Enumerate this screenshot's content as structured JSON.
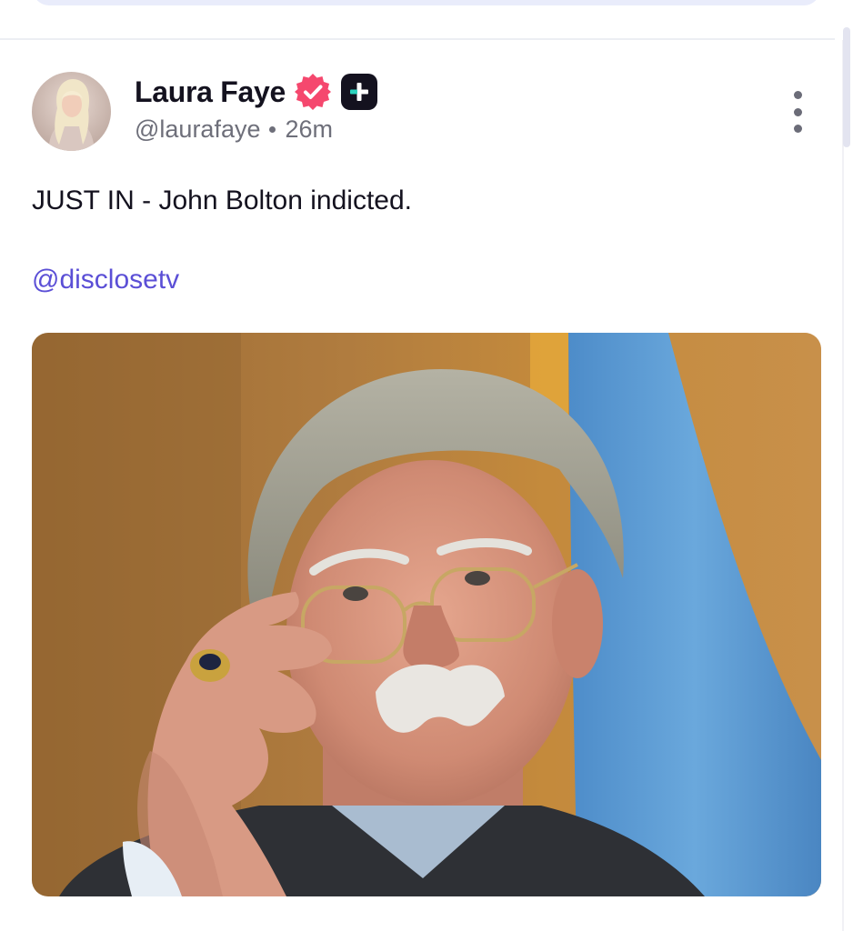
{
  "post": {
    "author": {
      "display_name": "Laura Faye",
      "handle": "@laurafaye",
      "verified_icon": "verified-badge-icon",
      "subscription_icon": "plus-badge-icon"
    },
    "time_ago": "26m",
    "text": "JUST IN - John Bolton indicted.",
    "mention": "@disclosetv",
    "more_icon": "more-vertical-icon"
  },
  "colors": {
    "mention": "#5b4fd6",
    "verified_badge": "#f5486e",
    "plus_badge": "#14121f",
    "plus_badge_accent": "#2dd4bf"
  }
}
